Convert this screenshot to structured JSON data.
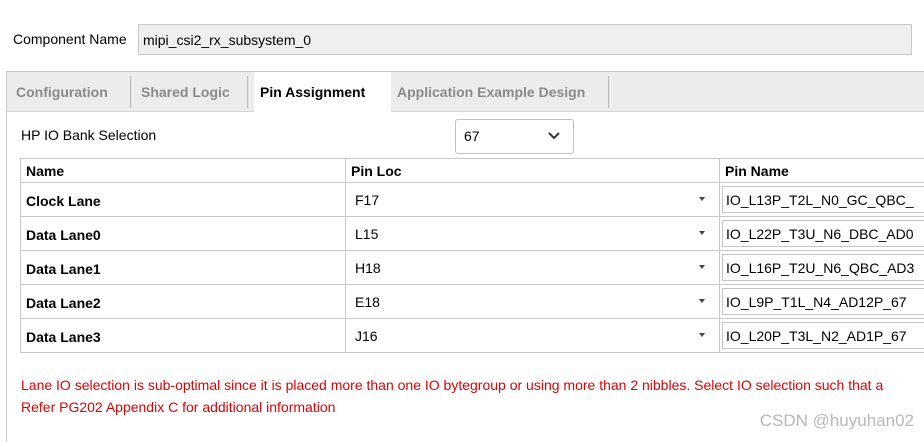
{
  "component": {
    "label": "Component Name",
    "value": "mipi_csi2_rx_subsystem_0"
  },
  "tabs": [
    {
      "label": "Configuration",
      "active": false
    },
    {
      "label": "Shared Logic",
      "active": false
    },
    {
      "label": "Pin Assignment",
      "active": true
    },
    {
      "label": "Application Example Design",
      "active": false
    }
  ],
  "hp_bank": {
    "label": "HP IO Bank Selection",
    "value": "67",
    "icon": "chevron-down-icon"
  },
  "table": {
    "columns": [
      "Name",
      "Pin Loc",
      "Pin Name"
    ],
    "rows": [
      {
        "name": "Clock Lane",
        "pin_loc": "F17",
        "pin_name": "IO_L13P_T2L_N0_GC_QBC_"
      },
      {
        "name": "Data Lane0",
        "pin_loc": "L15",
        "pin_name": "IO_L22P_T3U_N6_DBC_AD0"
      },
      {
        "name": "Data Lane1",
        "pin_loc": "H18",
        "pin_name": "IO_L16P_T2U_N6_QBC_AD3"
      },
      {
        "name": "Data Lane2",
        "pin_loc": "E18",
        "pin_name": "IO_L9P_T1L_N4_AD12P_67"
      },
      {
        "name": "Data Lane3",
        "pin_loc": "J16",
        "pin_name": "IO_L20P_T3L_N2_AD1P_67"
      }
    ]
  },
  "warnings": {
    "line1": "Lane IO selection is sub-optimal since it is placed more than one IO bytegroup or using more than 2 nibbles. Select IO selection such that a",
    "line2": "Refer PG202 Appendix C for additional information"
  },
  "watermark": "CSDN @huyuhan02",
  "colors": {
    "warning": "#e00000",
    "tab_inactive": "#8a8a8a",
    "border": "#c8c8c8"
  }
}
